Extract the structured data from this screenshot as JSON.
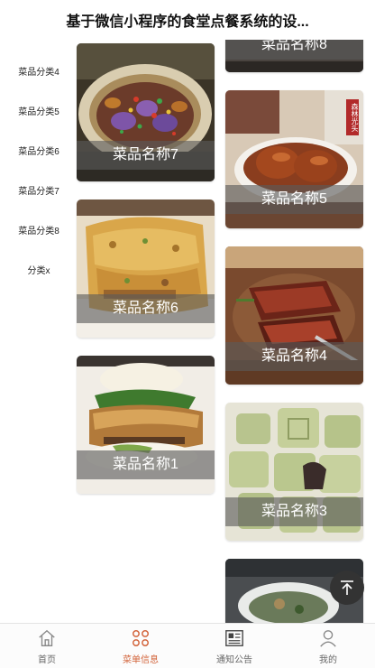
{
  "header": {
    "title": "基于微信小程序的食堂点餐系统的设..."
  },
  "sidebar": {
    "items": [
      {
        "label": "菜品分类4"
      },
      {
        "label": "菜品分类5"
      },
      {
        "label": "菜品分类6"
      },
      {
        "label": "菜品分类7"
      },
      {
        "label": "菜品分类8"
      },
      {
        "label": "分类x"
      }
    ]
  },
  "dishes": {
    "left": [
      {
        "name": "菜品名称7"
      },
      {
        "name": "菜品名称6"
      },
      {
        "name": "菜品名称1"
      }
    ],
    "right": [
      {
        "name": "菜品名称8"
      },
      {
        "name": "菜品名称5"
      },
      {
        "name": "菜品名称4"
      },
      {
        "name": "菜品名称3"
      }
    ]
  },
  "dish_badge": {
    "text": "森林光头"
  },
  "tabbar": {
    "items": [
      {
        "label": "首页",
        "icon": "home-icon"
      },
      {
        "label": "菜单信息",
        "icon": "menu-grid-icon"
      },
      {
        "label": "通知公告",
        "icon": "newspaper-icon"
      },
      {
        "label": "我的",
        "icon": "user-icon"
      }
    ],
    "active_color": "#d2633a",
    "inactive_color": "#666666"
  }
}
